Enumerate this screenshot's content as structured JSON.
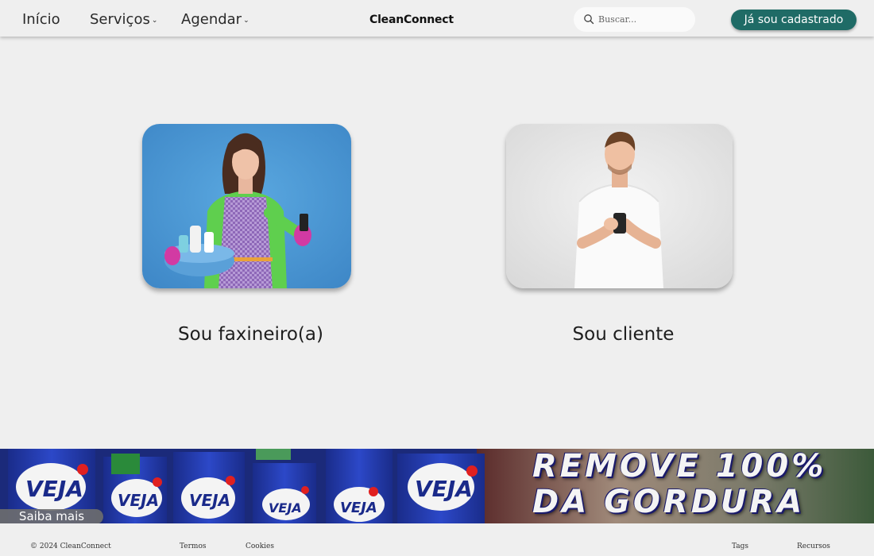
{
  "nav": {
    "inicio": "Início",
    "servicos": "Serviços",
    "agendar": "Agendar",
    "brand": "CleanConnect",
    "search_placeholder": "Buscar...",
    "cta": "Já sou cadastrado"
  },
  "cards": [
    {
      "label": "Sou faxineiro(a)",
      "image": "cleaner-woman-photo"
    },
    {
      "label": "Sou cliente",
      "image": "client-man-phone-photo"
    }
  ],
  "banner": {
    "brand_text": "VEJA",
    "line1": "REMOVE 100%",
    "line2": "DA GORDURA",
    "button": "Saiba mais"
  },
  "footer": {
    "copyright": "© 2024 CleanConnect",
    "links": [
      "Termos",
      "Cookies",
      "Tags",
      "Recursos"
    ]
  },
  "colors": {
    "accent": "#1f6b66",
    "background": "#efefef",
    "card_blue": "#4a95d2"
  },
  "icons": [
    "chevron-down-icon",
    "search-icon"
  ]
}
